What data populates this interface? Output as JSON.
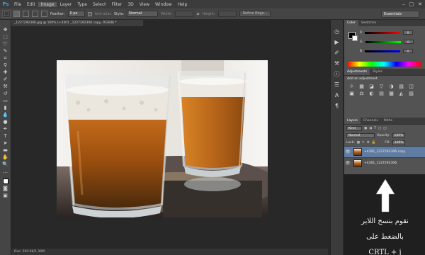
{
  "menubar": {
    "logo": "Ps",
    "items": [
      "File",
      "Edit",
      "Image",
      "Layer",
      "Type",
      "Select",
      "Filter",
      "3D",
      "View",
      "Window",
      "Help"
    ],
    "active_index": 2
  },
  "options": {
    "feather_label": "Feather:",
    "feather_value": "0 px",
    "anti_alias_label": "Anti-alias",
    "style_label": "Style:",
    "style_value": "Normal",
    "width_label": "Width:",
    "height_label": "Height:",
    "refine_label": "Refine Edge...",
    "workspace": "Essentials"
  },
  "document": {
    "tab_title": "_1227292306.jpg @ 100% (+4301 _1227292306 copy, RGB/8) *",
    "status": "Doc: 500.0K/1.39M"
  },
  "panels": {
    "color_tabs": [
      "Color",
      "Swatches"
    ],
    "color_channels": [
      {
        "label": "R",
        "value": "0"
      },
      {
        "label": "G",
        "value": "0"
      },
      {
        "label": "B",
        "value": "0"
      }
    ],
    "adjust_tabs": [
      "Adjustments",
      "Styles"
    ],
    "adjust_title": "Add an adjustment",
    "adjust_icons": [
      "☼",
      "▦",
      "◪",
      "▽",
      "◑",
      "▧",
      "◫",
      "▣",
      "⚖",
      "◐",
      "▤",
      "▩",
      "◭",
      "▨"
    ],
    "layers_tabs": [
      "Layers",
      "Channels",
      "Paths"
    ],
    "kind_label": "Kind",
    "blend_mode": "Normal",
    "opacity_label": "Opacity:",
    "opacity_value": "100%",
    "lock_label": "Lock:",
    "fill_label": "Fill:",
    "fill_value": "100%",
    "layers": [
      {
        "name": "+4301_1227292306 copy",
        "selected": true
      },
      {
        "name": "+4301_1227292306",
        "selected": false
      }
    ]
  },
  "annotation": {
    "line1": "نقوم بنسخ اللاير",
    "line2": "بالضغط على",
    "line3": "CRTL + j"
  }
}
